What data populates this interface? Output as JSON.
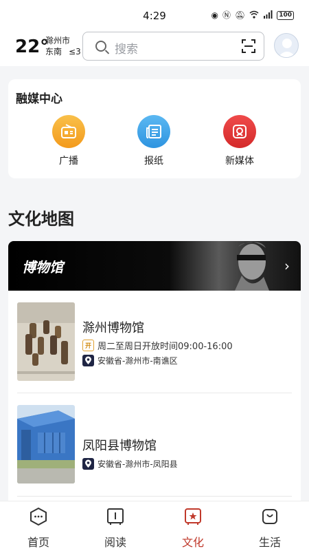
{
  "status_bar": {
    "time": "4:29",
    "battery": "100"
  },
  "header": {
    "temperature": "22°",
    "city": "滁州市",
    "wind_direction": "东南",
    "wind_level": "≤3",
    "search_placeholder": "搜索"
  },
  "media_center": {
    "title": "融媒中心",
    "items": [
      {
        "label": "广播",
        "icon": "radio-icon",
        "color": "#f6a623"
      },
      {
        "label": "报纸",
        "icon": "newspaper-icon",
        "color": "#3aa3e8"
      },
      {
        "label": "新媒体",
        "icon": "new-media-icon",
        "color": "#e03a3a"
      }
    ]
  },
  "culture_map": {
    "title": "文化地图",
    "banner_title": "博物馆",
    "museums": [
      {
        "name": "滁州博物馆",
        "open_tag": "开",
        "hours": "周二至周日开放时间09:00-16:00",
        "address": "安徽省-滁州市-南谯区"
      },
      {
        "name": "凤阳县博物馆",
        "address": "安徽省-滁州市-凤阳县"
      }
    ]
  },
  "tabs": [
    {
      "label": "首页",
      "icon": "home-icon",
      "active": false
    },
    {
      "label": "阅读",
      "icon": "book-icon",
      "active": false
    },
    {
      "label": "文化",
      "icon": "culture-icon",
      "active": true
    },
    {
      "label": "生活",
      "icon": "life-icon",
      "active": false
    }
  ],
  "colors": {
    "accent": "#c0392b",
    "background": "#f4f5f7"
  }
}
